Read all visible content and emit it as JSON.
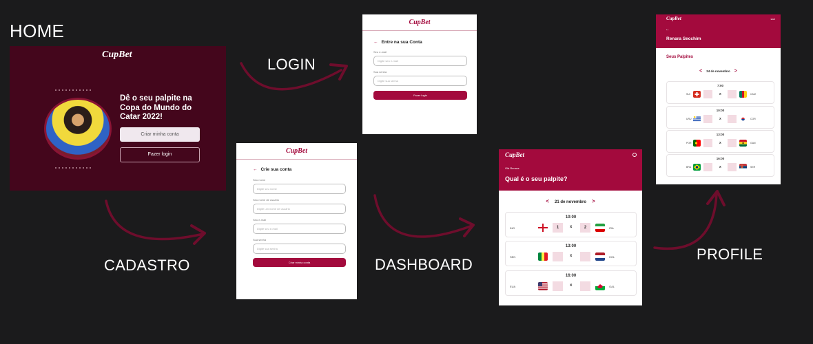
{
  "labels": {
    "home": "HOME",
    "login": "LOGIN",
    "cadastro": "CADASTRO",
    "dashboard": "DASHBOARD",
    "profile": "PROFILE"
  },
  "colors": {
    "background": "#1b1b1c",
    "brand": "#a30a3d",
    "home_bg": "#44061c",
    "arrow": "#6e0d2c"
  },
  "brand_logo": "CupBet",
  "home": {
    "headline": "Dê o seu palpite na Copa do Mundo do Catar 2022!",
    "create_account_button": "Criar minha conta",
    "login_button": "Fazer login"
  },
  "login": {
    "title": "Entre na sua Conta",
    "email_label": "Seu e-mail",
    "email_placeholder": "Digite seu e-mail",
    "password_label": "Sua senha",
    "password_placeholder": "Digite sua senha",
    "submit": "Fazer login"
  },
  "cadastro": {
    "title": "Crie sua conta",
    "fields": [
      {
        "label": "Seu nome",
        "placeholder": "Digite seu nome"
      },
      {
        "label": "Seu nome de usuário",
        "placeholder": "Digite um nome de usuário"
      },
      {
        "label": "Seu e-mail",
        "placeholder": "Digite seu e-mail"
      },
      {
        "label": "Sua senha",
        "placeholder": "Digite sua senha"
      }
    ],
    "submit": "Criar minha conta"
  },
  "dashboard": {
    "greeting": "Olá Renara",
    "question": "Qual é o seu palpite?",
    "date": "21 de novembro",
    "matches": [
      {
        "time": "10:00",
        "home": "ING",
        "away": "IRA",
        "home_flag": "england",
        "away_flag": "iran",
        "home_score": "1",
        "away_score": "2"
      },
      {
        "time": "13:00",
        "home": "SEN",
        "away": "HOL",
        "home_flag": "senegal",
        "away_flag": "netherlands",
        "home_score": "",
        "away_score": ""
      },
      {
        "time": "16:00",
        "home": "EUA",
        "away": "GAL",
        "home_flag": "usa",
        "away_flag": "wales",
        "home_score": "",
        "away_score": ""
      }
    ]
  },
  "profile": {
    "exit": "sair",
    "back": "←",
    "user_name": "Renara Secchim",
    "section_title": "Seus Palpites",
    "date": "24 de novembro",
    "matches": [
      {
        "time": "7:00",
        "home": "SUI",
        "away": "CAM",
        "home_flag": "switzerland",
        "away_flag": "cameroon"
      },
      {
        "time": "10:00",
        "home": "URU",
        "away": "COR",
        "home_flag": "uruguay",
        "away_flag": "korea"
      },
      {
        "time": "13:00",
        "home": "POR",
        "away": "GAN",
        "home_flag": "portugal",
        "away_flag": "ghana"
      },
      {
        "time": "16:00",
        "home": "BRA",
        "away": "SER",
        "home_flag": "brazil",
        "away_flag": "serbia"
      }
    ]
  }
}
